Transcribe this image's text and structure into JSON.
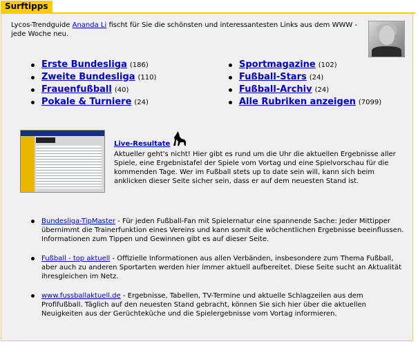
{
  "section": {
    "title": "Surftipps"
  },
  "intro": {
    "before": "Lycos-Trendguide ",
    "link": "Ananda Li",
    "after": " fischt für Sie die schönsten und interessantesten Links aus dem WWW - jede Woche neu."
  },
  "categories_left": [
    {
      "label": "Erste Bundesliga",
      "count": "(186)"
    },
    {
      "label": "Zweite Bundesliga",
      "count": "(110)"
    },
    {
      "label": "Frauenfußball",
      "count": "(40)"
    },
    {
      "label": "Pokale & Turniere",
      "count": "(24)"
    }
  ],
  "categories_right": [
    {
      "label": "Sportmagazine",
      "count": "(102)"
    },
    {
      "label": "Fußball-Stars",
      "count": "(24)"
    },
    {
      "label": "Fußball-Archiv",
      "count": "(24)"
    },
    {
      "label": "Alle Rubriken anzeigen",
      "count": "(7099)"
    }
  ],
  "feature": {
    "title": "Live-Resultate",
    "text": "Aktueller geht's nicht! Hier gibt es rund um die Uhr die aktuellen Ergebnisse aller Spiele, eine Ergebnistafel der Spiele vom Vortag und eine Spielvorschau für die kommenden Tage. Wer im Fußball stets up to date sein will, kann sich beim anklicken dieser Seite sicher sein, dass er auf dem neuesten Stand ist."
  },
  "links": [
    {
      "link": "Bundesliga-TipMaster",
      "text": "  -  Für jeden Fußball-Fan mit Spielernatur eine spannende Sache: Jeder Mittipper übernimmt die Trainerfunktion eines Vereins und kann somit die wöchentlichen Ergebnisse beeinflussen. Informationen zum Tippen und Gewinnen gibt es auf dieser Seite."
    },
    {
      "link": "Fußball - top aktuell",
      "text": "  -  Offizielle Informationen aus allen Verbänden, insbesondere zum Thema Fußball, aber auch zu anderen Sportarten werden hier immer aktuell aufbereitet. Diese Seite sucht an Aktualität ihresgleichen im Netz."
    },
    {
      "link": "www.fussballaktuell.de",
      "text": "  -  Ergebnisse, Tabellen, TV-Termine und aktuelle Schlagzeilen aus dem Profifußball. Täglich auf den neuesten Stand gebracht, können Sie sich hier über die aktuellen Neuigkeiten aus der Gerüchteküche und die Spielergebnisse vom Vortag informieren."
    }
  ],
  "icons": {
    "avatar": "trendguide-portrait",
    "screenshot": "live-resultate-screenshot",
    "mascot": "lycos-dog-icon"
  }
}
